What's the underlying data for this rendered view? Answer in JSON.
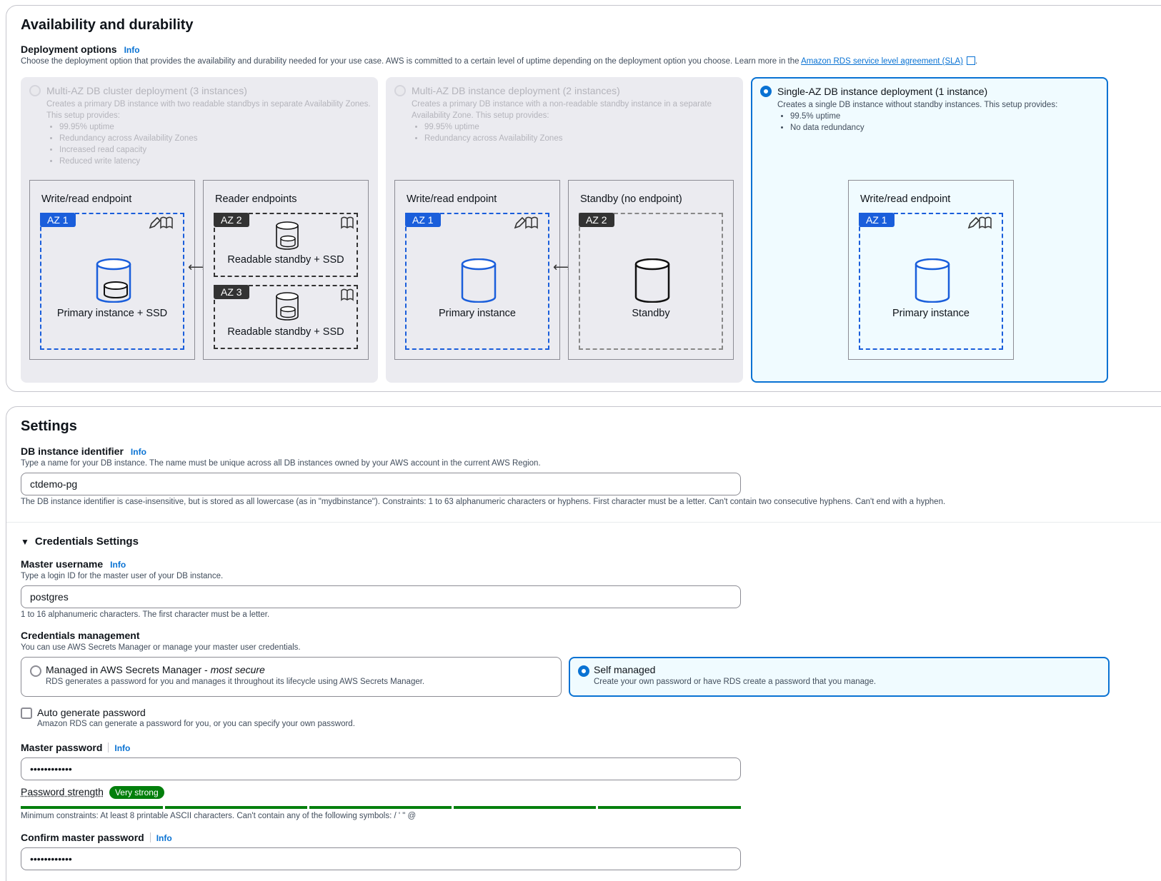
{
  "availability": {
    "title": "Availability and durability",
    "deployment_label": "Deployment options",
    "info": "Info",
    "deployment_desc": "Choose the deployment option that provides the availability and durability needed for your use case. AWS is committed to a certain level of uptime depending on the deployment option you choose. Learn more in the",
    "sla_link": "Amazon RDS service level agreement (SLA)",
    "options": [
      {
        "title": "Multi-AZ DB cluster deployment (3 instances)",
        "desc": "Creates a primary DB instance with two readable standbys in separate Availability Zones. This setup provides:",
        "bullets": [
          "99.95% uptime",
          "Redundancy across Availability Zones",
          "Increased read capacity",
          "Reduced write latency"
        ],
        "state": "disabled"
      },
      {
        "title": "Multi-AZ DB instance deployment (2 instances)",
        "desc": "Creates a primary DB instance with a non-readable standby instance in a separate Availability Zone. This setup provides:",
        "bullets": [
          "99.95% uptime",
          "Redundancy across Availability Zones"
        ],
        "state": "disabled"
      },
      {
        "title": "Single-AZ DB instance deployment (1 instance)",
        "desc": "Creates a single DB instance without standby instances. This setup provides:",
        "bullets": [
          "99.5% uptime",
          "No data redundancy"
        ],
        "state": "selected"
      }
    ],
    "diagrams": {
      "write_read": "Write/read endpoint",
      "reader": "Reader endpoints",
      "standby_no": "Standby (no endpoint)",
      "az1": "AZ 1",
      "az2": "AZ 2",
      "az3": "AZ 3",
      "primary_ssd": "Primary instance + SSD",
      "readable_ssd": "Readable standby + SSD",
      "primary": "Primary instance",
      "standby": "Standby"
    }
  },
  "settings": {
    "title": "Settings",
    "id_label": "DB instance identifier",
    "info": "Info",
    "id_desc": "Type a name for your DB instance. The name must be unique across all DB instances owned by your AWS account in the current AWS Region.",
    "id_value": "ctdemo-pg",
    "id_constraint": "The DB instance identifier is case-insensitive, but is stored as all lowercase (as in \"mydbinstance\"). Constraints: 1 to 63 alphanumeric characters or hyphens. First character must be a letter. Can't contain two consecutive hyphens. Can't end with a hyphen.",
    "cred_header": "Credentials Settings",
    "master_user_label": "Master username",
    "master_user_desc": "Type a login ID for the master user of your DB instance.",
    "master_user_value": "postgres",
    "master_user_constraint": "1 to 16 alphanumeric characters. The first character must be a letter.",
    "cred_mgmt_label": "Credentials management",
    "cred_mgmt_desc": "You can use AWS Secrets Manager or manage your master user credentials.",
    "managed_title": "Managed in AWS Secrets Manager - ",
    "managed_title_em": "most secure",
    "managed_desc": "RDS generates a password for you and manages it throughout its lifecycle using AWS Secrets Manager.",
    "self_title": "Self managed",
    "self_desc": "Create your own password or have RDS create a password that you manage.",
    "auto_gen_label": "Auto generate password",
    "auto_gen_desc": "Amazon RDS can generate a password for you, or you can specify your own password.",
    "master_pw_label": "Master password",
    "master_pw_value": "••••••••••••",
    "pw_strength_label": "Password strength",
    "pw_strength_value": "Very strong",
    "pw_strength_level": 1.0,
    "pw_constraint": "Minimum constraints: At least 8 printable ASCII characters. Can't contain any of the following symbols: / ' \" @",
    "confirm_pw_label": "Confirm master password",
    "confirm_pw_value": "••••••••••••"
  }
}
